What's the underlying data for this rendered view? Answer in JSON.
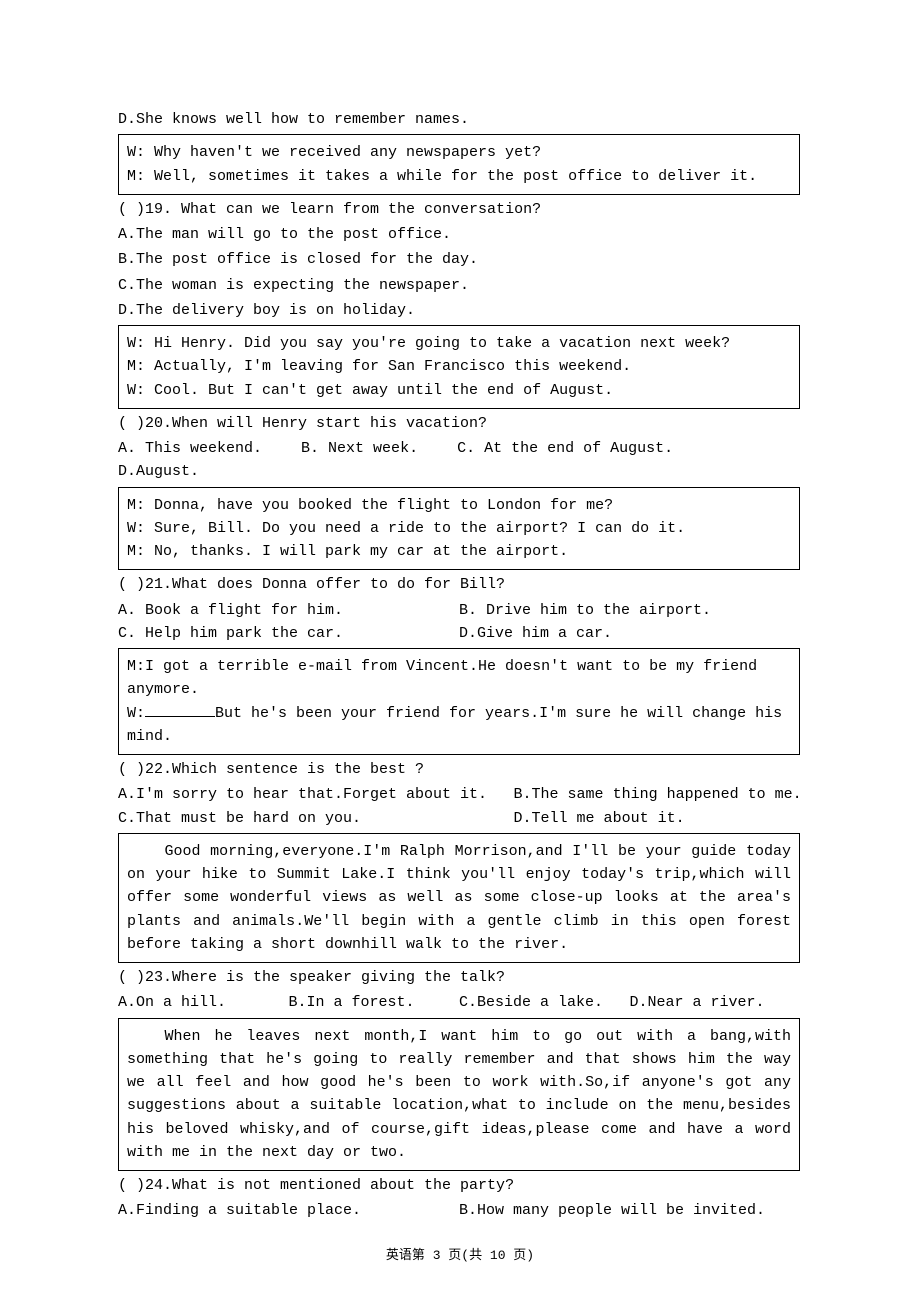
{
  "top_line": "D.She knows well how to remember names.",
  "q19": {
    "dialog1": "W: Why haven't we received any newspapers yet?",
    "dialog2": "M: Well, sometimes it takes a while for the post office to deliver it.",
    "stem": "(   )19.  What can we learn from the conversation?",
    "a": "A.The man will go to the post office.",
    "b": "B.The post office is closed for the day.",
    "c": "C.The woman is expecting the newspaper.",
    "d": "D.The delivery boy is on holiday."
  },
  "q20": {
    "dialog1": "W: Hi Henry. Did you say you're going to take a vacation next week?",
    "dialog2": "M: Actually, I'm leaving for San Francisco this weekend.",
    "dialog3": "W: Cool. But I can't get away until the end of August.",
    "stem": "(   )20.When will Henry start his vacation?",
    "a": "A. This weekend.",
    "b": "B. Next week.",
    "c": "C. At the end of August.",
    "d": "D.August."
  },
  "q21": {
    "dialog1": "M: Donna, have you booked the flight to London for me?",
    "dialog2": "W: Sure, Bill. Do you need a ride to the airport? I can do it.",
    "dialog3": "M: No, thanks. I will park my car at the airport.",
    "stem": "(   )21.What does Donna offer to do for Bill?",
    "a": "A. Book a flight for him.",
    "b": "B. Drive him to the airport.",
    "c": "C. Help him park the car.",
    "d": "D.Give him a car."
  },
  "q22": {
    "dialog1": "M:I got a terrible e-mail from Vincent.He doesn't want to be my friend anymore.",
    "dialog2_pre": "W:",
    "dialog2_post": "But he's been your friend for years.I'm sure he will change his mind.",
    "stem": "(   )22.Which sentence is the best ?",
    "a": "A.I'm sorry to hear that.Forget about it.",
    "b": "B.The same thing happened to me.",
    "c": "C.That must be hard on you.",
    "d": "D.Tell me about it."
  },
  "q23": {
    "passage": "Good morning,everyone.I'm Ralph Morrison,and I'll be your guide today on your hike to Summit Lake.I think you'll enjoy today's trip,which will offer some wonderful views as well as some close-up looks at the area's plants and animals.We'll begin with a gentle climb in this open forest before taking a short downhill walk to the river.",
    "stem": "(   )23.Where is the speaker giving the talk?",
    "a": "A.On a hill.",
    "b": "B.In a forest.",
    "c": "C.Beside a lake.",
    "d": "D.Near a river."
  },
  "q24": {
    "passage": "When he leaves next month,I want him to go out with a bang,with something that he's going to really remember and that shows him the way we all feel and how good he's been to work with.So,if anyone's got any suggestions about a suitable location,what to include on the menu,besides his beloved whisky,and of course,gift ideas,please come and have a word with me in the next day or two.",
    "stem": "(   )24.What is not mentioned about the party?",
    "a": "A.Finding a suitable place.",
    "b": "B.How many people will be invited."
  },
  "footer": "英语第 3 页(共 10 页)"
}
